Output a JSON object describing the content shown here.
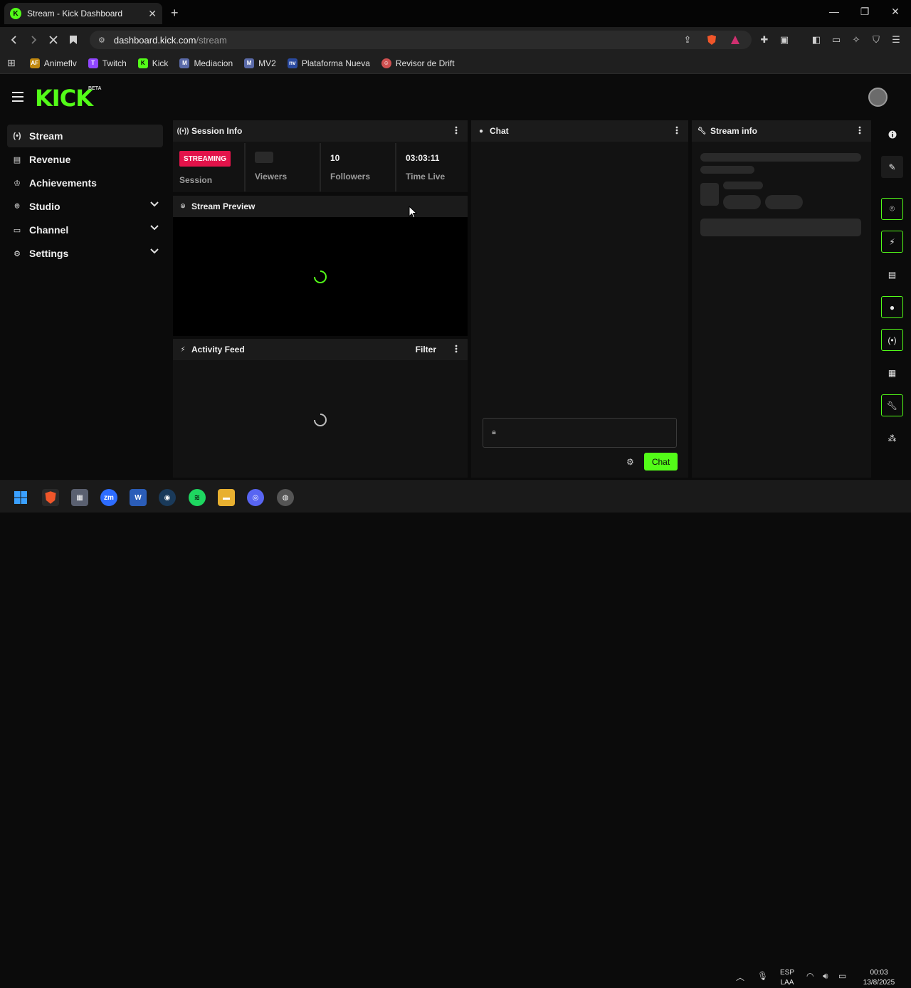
{
  "browser": {
    "tab_title": "Stream - Kick Dashboard",
    "tab_close": "✕",
    "new_tab": "+",
    "url_host": "dashboard.kick.com",
    "url_path": "/stream",
    "bookmarks": [
      {
        "label": "Animeflv",
        "icon": "AF",
        "color": "#e0a020"
      },
      {
        "label": "Twitch",
        "icon": "T",
        "color": "#9146ff"
      },
      {
        "label": "Kick",
        "icon": "K",
        "color": "#53fc18"
      },
      {
        "label": "Mediacion",
        "icon": "M",
        "color": "#5a6aa8"
      },
      {
        "label": "MV2",
        "icon": "M",
        "color": "#5a6aa8"
      },
      {
        "label": "Plataforma Nueva",
        "icon": "nv",
        "color": "#2a4aa0"
      },
      {
        "label": "Revisor de Drift",
        "icon": "☺",
        "color": "#d05050"
      }
    ]
  },
  "kick": {
    "logo_text": "KICK",
    "beta": "BETA"
  },
  "sidebar": {
    "items": [
      {
        "label": "Stream",
        "icon": "broadcast-icon"
      },
      {
        "label": "Revenue",
        "icon": "revenue-icon"
      },
      {
        "label": "Achievements",
        "icon": "trophy-icon"
      },
      {
        "label": "Studio",
        "icon": "studio-icon"
      },
      {
        "label": "Channel",
        "icon": "channel-icon"
      },
      {
        "label": "Settings",
        "icon": "gear-icon"
      }
    ]
  },
  "session_info": {
    "title": "Session Info",
    "badge": "STREAMING",
    "session_label": "Session",
    "viewers_label": "Viewers",
    "followers_value": "10",
    "followers_label": "Followers",
    "time_value": "03:03:11",
    "time_label": "Time Live"
  },
  "stream_preview": {
    "title": "Stream Preview"
  },
  "activity_feed": {
    "title": "Activity Feed",
    "filter": "Filter"
  },
  "chat": {
    "title": "Chat",
    "send_label": "Chat"
  },
  "stream_info": {
    "title": "Stream info"
  },
  "colors": {
    "accent": "#53fc18",
    "badge": "#e3134a"
  },
  "taskbar": {
    "lang": "ESP",
    "lang_sub": "LAA",
    "time": "00:03",
    "date": "13/8/2025"
  }
}
